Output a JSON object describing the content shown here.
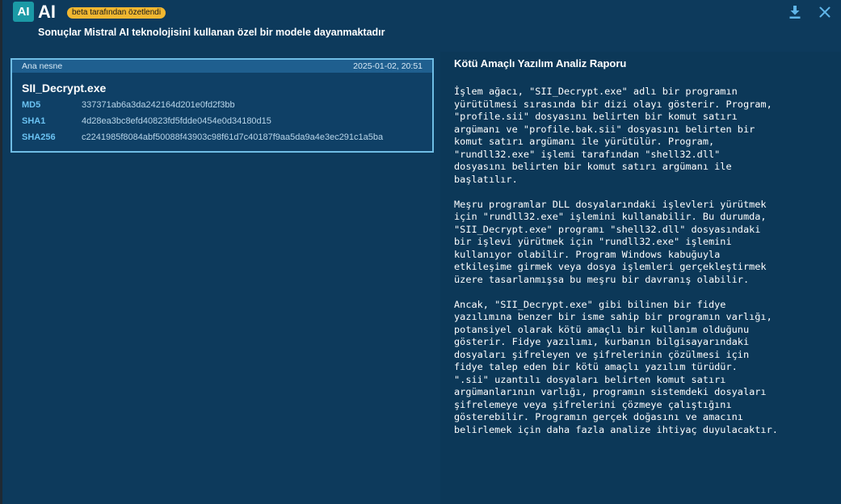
{
  "header": {
    "logo_text": "AI",
    "title": "AI",
    "badge": "beta tarafından özetlendi",
    "subtitle": "Sonuçlar Mistral AI teknolojisini kullanan özel bir modele dayanmaktadır",
    "download_icon": "download-icon",
    "close_icon": "close-icon"
  },
  "object": {
    "label": "Ana nesne",
    "timestamp": "2025-01-02, 20:51",
    "name": "SII_Decrypt.exe",
    "hashes": [
      {
        "label": "MD5",
        "value": "337371ab6a3da242164d201e0fd2f3bb"
      },
      {
        "label": "SHA1",
        "value": "4d28ea3bc8efd40823fd5fdde0454e0d34180d15"
      },
      {
        "label": "SHA256",
        "value": "c2241985f8084abf50088f43903c98f61d7c40187f9aa5da9a4e3ec291c1a5ba"
      }
    ]
  },
  "report": {
    "title": "Kötü Amaçlı Yazılım Analiz Raporu",
    "paragraphs": [
      "İşlem ağacı, \"SII_Decrypt.exe\" adlı bir programın\nyürütülmesi sırasında bir dizi olayı gösterir. Program,\n\"profile.sii\" dosyasını belirten bir komut satırı\nargümanı ve \"profile.bak.sii\" dosyasını belirten bir\nkomut satırı argümanı ile yürütülür. Program,\n\"rundll32.exe\" işlemi tarafından \"shell32.dll\"\ndosyasını belirten bir komut satırı argümanı ile\nbaşlatılır.",
      "Meşru programlar DLL dosyalarındaki işlevleri yürütmek\niçin \"rundll32.exe\" işlemini kullanabilir. Bu durumda,\n\"SII_Decrypt.exe\" programı \"shell32.dll\" dosyasındaki\nbir işlevi yürütmek için \"rundll32.exe\" işlemini\nkullanıyor olabilir. Program Windows kabuğuyla\netkileşime girmek veya dosya işlemleri gerçekleştirmek\nüzere tasarlanmışsa bu meşru bir davranış olabilir.",
      "Ancak, \"SII_Decrypt.exe\" gibi bilinen bir fidye\nyazılımına benzer bir isme sahip bir programın varlığı,\npotansiyel olarak kötü amaçlı bir kullanım olduğunu\ngösterir. Fidye yazılımı, kurbanın bilgisayarındaki\ndosyaları şifreleyen ve şifrelerinin çözülmesi için\nfidye talep eden bir kötü amaçlı yazılım türüdür.\n\".sii\" uzantılı dosyaları belirten komut satırı\nargümanlarının varlığı, programın sistemdeki dosyaları\nşifrelemeye veya şifrelerini çözmeye çalıştığını\ngösterebilir. Programın gerçek doğasını ve amacını\nbelirlemek için daha fazla analize ihtiyaç duyulacaktır."
    ]
  },
  "colors": {
    "background": "#0d3a5c",
    "accent": "#6fbde5",
    "badge": "#f1b730",
    "logo": "#1b9aa6"
  }
}
